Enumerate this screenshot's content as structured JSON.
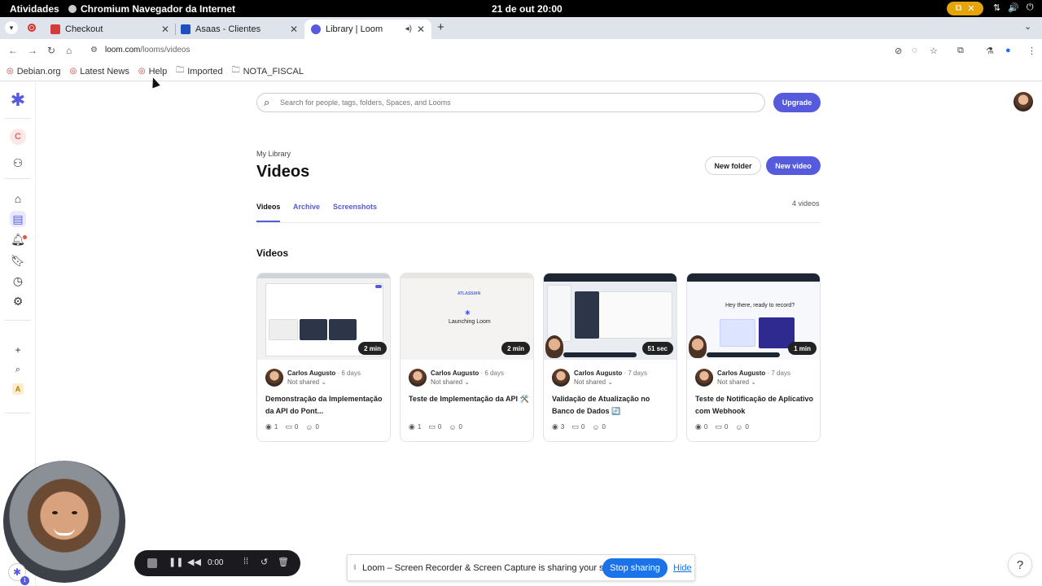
{
  "os_bar": {
    "activities": "Atividades",
    "app_name": "Chromium Navegador da Internet",
    "clock": "21 de out  20:00"
  },
  "tabs": [
    {
      "title": "Checkout",
      "fav_color": "#d23c3c"
    },
    {
      "title": "Asaas - Clientes",
      "fav_color": "#1c4fbf"
    },
    {
      "title": "Library | Loom",
      "fav_color": "#565ADD"
    }
  ],
  "address": {
    "host": "loom.com",
    "path": "/looms/videos"
  },
  "bookmarks": [
    {
      "label": "Debian.org",
      "type": "site"
    },
    {
      "label": "Latest News",
      "type": "site"
    },
    {
      "label": "Help",
      "type": "site"
    },
    {
      "label": "Imported",
      "type": "folder"
    },
    {
      "label": "NOTA_FISCAL",
      "type": "folder"
    }
  ],
  "rail": {
    "workspace_initial": "C",
    "bottom_initial": "A"
  },
  "search": {
    "placeholder": "Search for people, tags, folders, Spaces, and Looms"
  },
  "header": {
    "upgrade": "Upgrade",
    "breadcrumb": "My Library",
    "title": "Videos",
    "new_folder": "New folder",
    "new_video": "New video"
  },
  "subtabs": [
    "Videos",
    "Archive",
    "Screenshots"
  ],
  "video_count": "4 videos",
  "section_title": "Videos",
  "videos": [
    {
      "duration": "2 min",
      "author": "Carlos Augusto",
      "age": "· 6 days",
      "share": "Not shared",
      "title": "Demonstração da Implementação da API do Pont...",
      "views": "1",
      "comments": "0",
      "reactions": "0"
    },
    {
      "duration": "2 min",
      "author": "Carlos Augusto",
      "age": "· 6 days",
      "share": "Not shared",
      "title": "Teste de Implementação da API 🛠️",
      "views": "1",
      "comments": "0",
      "reactions": "0"
    },
    {
      "duration": "51 sec",
      "author": "Carlos Augusto",
      "age": "· 7 days",
      "share": "Not shared",
      "title": "Validação de Atualização no Banco de Dados 🔄",
      "views": "3",
      "comments": "0",
      "reactions": "0"
    },
    {
      "duration": "1 min",
      "author": "Carlos Augusto",
      "age": "· 7 days",
      "share": "Not shared",
      "title": "Teste de Notificação de Aplicativo com Webhook",
      "views": "0",
      "comments": "0",
      "reactions": "0"
    }
  ],
  "thumb_text": {
    "t2": "Launching Loom",
    "t2_brand": "ATLASSIAN",
    "t4": "Hey there, ready to record?"
  },
  "recorder": {
    "time": "0:00",
    "badge_count": "1"
  },
  "share_bar": {
    "message": "Loom – Screen Recorder & Screen Capture is sharing your screen.",
    "stop": "Stop sharing",
    "hide": "Hide"
  },
  "help": "?",
  "colors": {
    "brand": "#565ADD",
    "chrome_blue": "#1a73e8"
  }
}
